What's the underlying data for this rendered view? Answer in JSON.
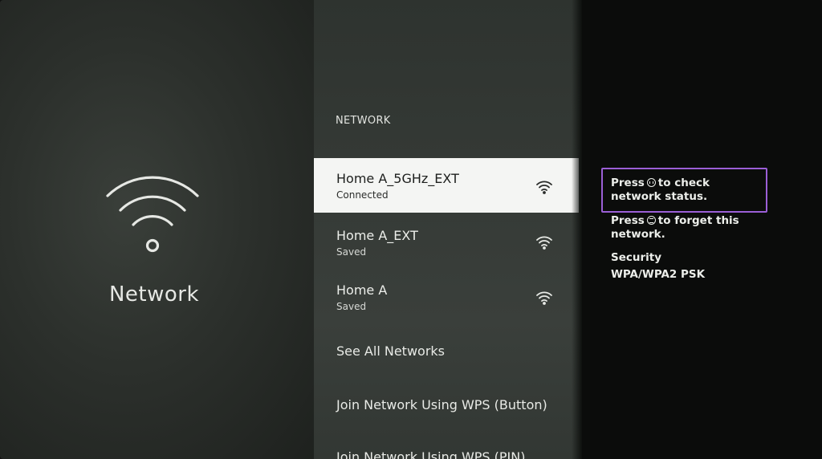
{
  "left_panel": {
    "title": "Network",
    "icon": "wifi-icon"
  },
  "list": {
    "header": "NETWORK",
    "networks": [
      {
        "name": "Home A_5GHz_EXT",
        "status": "Connected",
        "icon": "wifi-icon",
        "selected": true
      },
      {
        "name": "Home A_EXT",
        "status": "Saved",
        "icon": "wifi-icon",
        "selected": false
      },
      {
        "name": "Home A",
        "status": "Saved",
        "icon": "wifi-icon",
        "selected": false
      }
    ],
    "actions": [
      {
        "label": "See All Networks"
      },
      {
        "label": "Join Network Using WPS (Button)"
      },
      {
        "label": "Join Network Using WPS (PIN)"
      }
    ]
  },
  "info": {
    "hint_check_prefix": "Press",
    "hint_check_icon": "play-pause-button-icon",
    "hint_check_suffix": "to check network status.",
    "hint_forget_prefix": "Press",
    "hint_forget_icon": "menu-button-icon",
    "hint_forget_suffix": "to forget this network.",
    "security_label": "Security",
    "security_value": "WPA/WPA2 PSK"
  },
  "colors": {
    "highlight_border": "#9b5fd6",
    "selected_bg": "#f4f5f3"
  }
}
